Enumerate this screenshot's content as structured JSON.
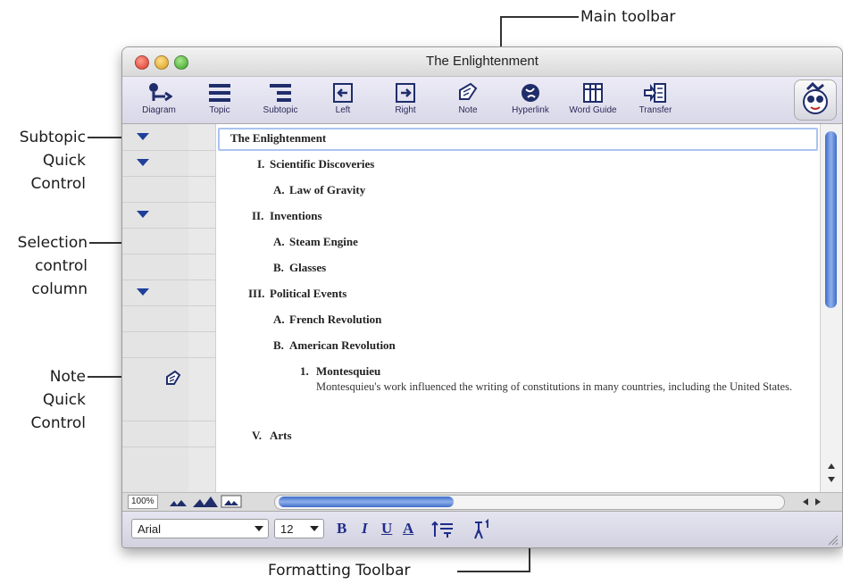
{
  "callouts": {
    "main_toolbar": "Main toolbar",
    "subtopic_quick_control": [
      "Subtopic",
      "Quick",
      "Control"
    ],
    "selection_control_column": [
      "Selection",
      "control",
      "column"
    ],
    "note_quick_control": [
      "Note",
      "Quick",
      "Control"
    ],
    "formatting_toolbar": "Formatting Toolbar"
  },
  "window": {
    "title": "The Enlightenment"
  },
  "toolbar": {
    "buttons": [
      {
        "label": "Diagram",
        "icon": "diagram-icon"
      },
      {
        "label": "Topic",
        "icon": "topic-icon"
      },
      {
        "label": "Subtopic",
        "icon": "subtopic-icon"
      },
      {
        "label": "Left",
        "icon": "left-arrow-icon"
      },
      {
        "label": "Right",
        "icon": "right-arrow-icon"
      },
      {
        "label": "Note",
        "icon": "note-icon"
      },
      {
        "label": "Hyperlink",
        "icon": "hyperlink-icon"
      },
      {
        "label": "Word Guide",
        "icon": "word-guide-icon"
      },
      {
        "label": "Transfer",
        "icon": "transfer-icon"
      }
    ]
  },
  "outline": {
    "root": "The Enlightenment",
    "rows": [
      {
        "num": "I.",
        "text": "Scientific Discoveries"
      },
      {
        "num": "A.",
        "text": "Law of Gravity"
      },
      {
        "num": "II.",
        "text": "Inventions"
      },
      {
        "num": "A.",
        "text": "Steam Engine"
      },
      {
        "num": "B.",
        "text": "Glasses"
      },
      {
        "num": "III.",
        "text": "Political Events"
      },
      {
        "num": "A.",
        "text": "French Revolution"
      },
      {
        "num": "B.",
        "text": "American Revolution"
      },
      {
        "num": "1.",
        "text": "Montesquieu"
      },
      {
        "num": "V.",
        "text": "Arts"
      }
    ],
    "note": "Montesquieu's work influenced the writing of constitutions in many countries, including the United States."
  },
  "bottom_strip": {
    "zoom": "100%"
  },
  "formatting": {
    "font": "Arial",
    "size": "12",
    "bold": "B",
    "italic": "I",
    "underline": "U",
    "text_color": "A"
  },
  "colors": {
    "accent": "#1f3f9a",
    "scroll_thumb": "#5b84d8"
  }
}
